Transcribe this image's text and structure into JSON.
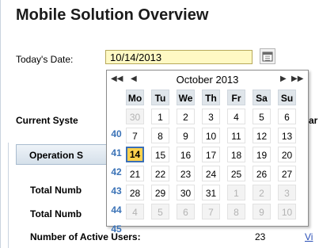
{
  "page": {
    "title": "Mobile Solution Overview",
    "date_label": "Today's Date:",
    "date_value": "10/14/2013"
  },
  "background": {
    "current_system_label": "Current Syste",
    "current_system_cut": "ar",
    "operation_header": "Operation S",
    "total_1": "Total Numb",
    "total_2": "Total Numb",
    "active_users_label": "Number of Active Users:",
    "active_users_value": "23",
    "link_text": "Vi"
  },
  "calendar": {
    "month_label": "October 2013",
    "nav": {
      "prev_year": "◀◀",
      "prev_month": "◀",
      "next_month": "▶",
      "next_year": "▶▶"
    },
    "day_headers": [
      "Mo",
      "Tu",
      "We",
      "Th",
      "Fr",
      "Sa",
      "Su"
    ],
    "weeks": [
      {
        "week": "40",
        "days": [
          "30",
          "1",
          "2",
          "3",
          "4",
          "5",
          "6"
        ],
        "other": [
          true,
          false,
          false,
          false,
          false,
          false,
          false
        ]
      },
      {
        "week": "41",
        "days": [
          "7",
          "8",
          "9",
          "10",
          "11",
          "12",
          "13"
        ],
        "other": [
          false,
          false,
          false,
          false,
          false,
          false,
          false
        ]
      },
      {
        "week": "42",
        "days": [
          "14",
          "15",
          "16",
          "17",
          "18",
          "19",
          "20"
        ],
        "other": [
          false,
          false,
          false,
          false,
          false,
          false,
          false
        ]
      },
      {
        "week": "43",
        "days": [
          "21",
          "22",
          "23",
          "24",
          "25",
          "26",
          "27"
        ],
        "other": [
          false,
          false,
          false,
          false,
          false,
          false,
          false
        ]
      },
      {
        "week": "44",
        "days": [
          "28",
          "29",
          "30",
          "31",
          "1",
          "2",
          "3"
        ],
        "other": [
          false,
          false,
          false,
          false,
          true,
          true,
          true
        ]
      },
      {
        "week": "45",
        "days": [
          "4",
          "5",
          "6",
          "7",
          "8",
          "9",
          "10"
        ],
        "other": [
          true,
          true,
          true,
          true,
          true,
          true,
          true
        ]
      }
    ],
    "selected_day": "14"
  },
  "colors": {
    "accent": "#3b73b7",
    "today_fill": "#ffd24d",
    "input_fill": "#fff9c4"
  },
  "icons": {
    "calendar_button": "calendar-icon"
  }
}
